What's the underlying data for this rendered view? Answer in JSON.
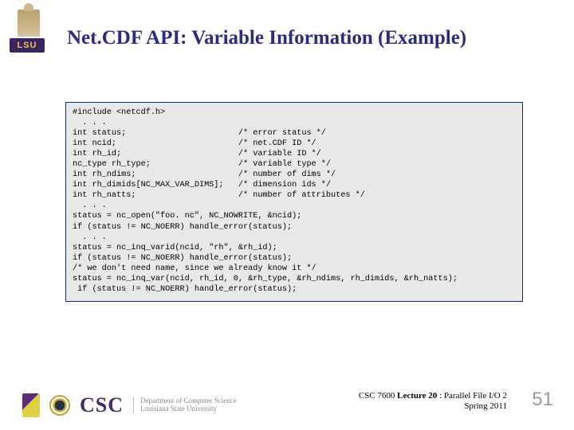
{
  "badge": {
    "label": "LSU"
  },
  "title": "Net.CDF API: Variable Information (Example)",
  "code": "#include <netcdf.h>\n  . . .\nint status;                       /* error status */\nint ncid;                         /* net.CDF ID */\nint rh_id;                        /* variable ID */\nnc_type rh_type;                  /* variable type */\nint rh_ndims;                     /* number of dims */\nint rh_dimids[NC_MAX_VAR_DIMS];   /* dimension ids */\nint rh_natts;                     /* number of attributes */\n  . . .\nstatus = nc_open(\"foo. nc\", NC_NOWRITE, &ncid);\nif (status != NC_NOERR) handle_error(status);\n  . . .\nstatus = nc_inq_varid(ncid, \"rh\", &rh_id);\nif (status != NC_NOERR) handle_error(status);\n/* we don't need name, since we already know it */\nstatus = nc_inq_var(ncid, rh_id, 0, &rh_type, &rh_ndims, rh_dimids, &rh_natts);\n if (status != NC_NOERR) handle_error(status);",
  "footer": {
    "csc": "CSC",
    "dept_line1": "Department of Computer Science",
    "dept_line2": "Louisiana State University",
    "course": "CSC 7600 ",
    "lecture": "Lecture 20",
    "tail": " : Parallel File I/O 2",
    "term": "Spring 2011",
    "page": "51"
  }
}
